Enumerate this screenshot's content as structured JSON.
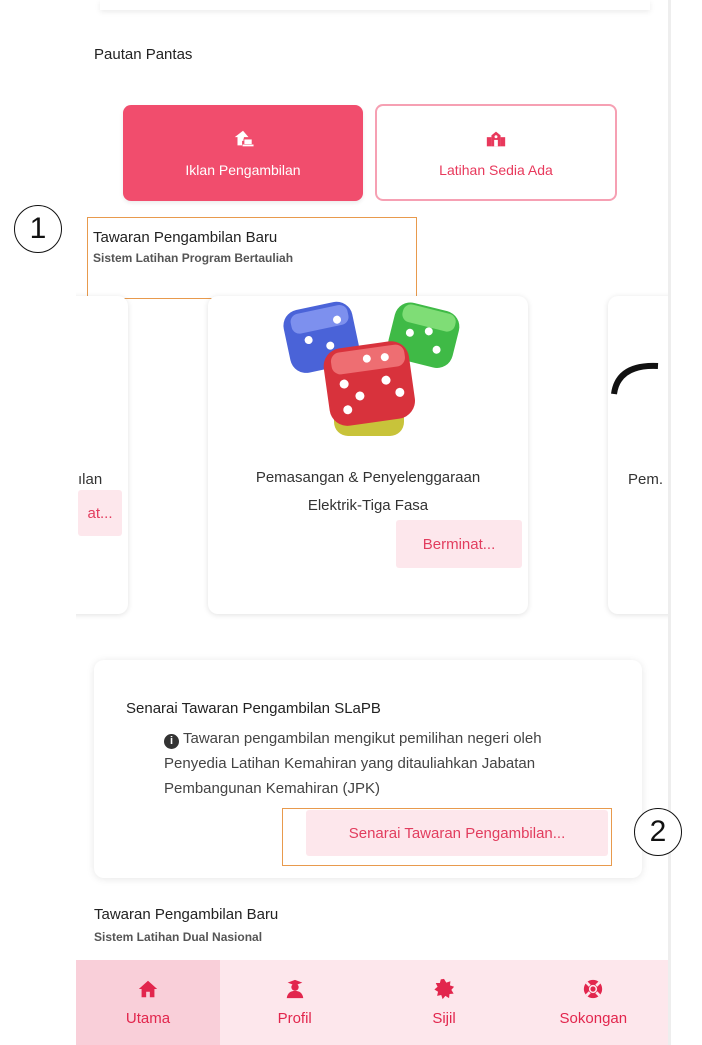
{
  "quick_links": {
    "title": "Pautan Pantas",
    "primary_label": "Iklan Pengambilan",
    "secondary_label": "Latihan Sedia Ada"
  },
  "section1": {
    "title": "Tawaran Pengambilan Baru",
    "subtitle": "Sistem Latihan Program Bertauliah",
    "callout": "1"
  },
  "carousel": {
    "left_card": {
      "title_fragment": "ılan",
      "button_fragment": "at..."
    },
    "center_card": {
      "image_icon": "dice-image",
      "title_line1": "Pemasangan & Penyelenggaraan",
      "title_line2": "Elektrik-Tiga Fasa",
      "button": "Berminat..."
    },
    "right_card": {
      "title_fragment": "Pem."
    }
  },
  "slapb": {
    "title": "Senarai Tawaran Pengambilan SLaPB",
    "info_icon": "info-icon",
    "text": "Tawaran pengambilan mengikut pemilihan negeri oleh Penyedia Latihan Kemahiran yang ditauliahkan Jabatan Pembangunan Kemahiran (JPK)",
    "button": "Senarai Tawaran Pengambilan...",
    "callout": "2"
  },
  "section2": {
    "title": "Tawaran Pengambilan Baru",
    "subtitle": "Sistem Latihan Dual Nasional"
  },
  "nav": {
    "items": [
      {
        "label": "Utama",
        "icon": "home-icon"
      },
      {
        "label": "Profil",
        "icon": "profile-icon"
      },
      {
        "label": "Sijil",
        "icon": "certificate-icon"
      },
      {
        "label": "Sokongan",
        "icon": "lifebuoy-icon"
      }
    ]
  },
  "colors": {
    "accent": "#f14d6d",
    "accent_dark": "#e2264d",
    "pink_bg": "#fde7ec",
    "highlight": "#e89a4d"
  }
}
